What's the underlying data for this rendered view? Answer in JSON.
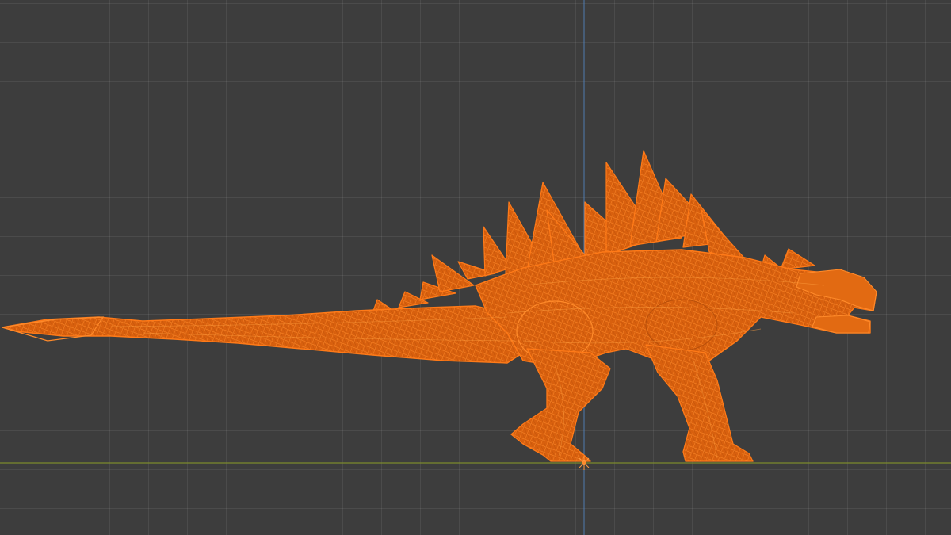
{
  "viewport": {
    "view": "orthographic-side",
    "shading": "wireframe",
    "grid": true,
    "colors": {
      "background": "#3d3d3d",
      "grid_line": "#4a4a4a",
      "x_axis": "#7c8a2c",
      "z_axis": "#4f7cb0",
      "selection": "#ff6a00",
      "selection_fill": "#e0660f"
    }
  },
  "selected_object": {
    "type": "mesh",
    "subject": "spined-dinosaur-kaiju",
    "selected": true
  },
  "origin_marker": {
    "icon": "object-origin-icon"
  }
}
